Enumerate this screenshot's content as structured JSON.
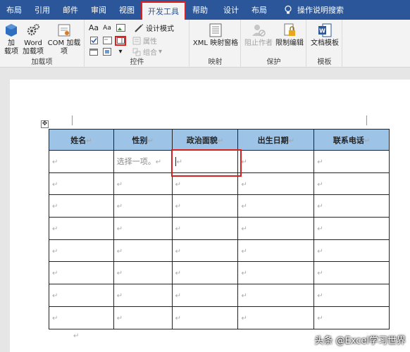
{
  "tabs": [
    "布局",
    "引用",
    "邮件",
    "审阅",
    "视图",
    "开发工具",
    "帮助",
    "设计",
    "布局"
  ],
  "active_tab": "开发工具",
  "tell_me": "操作说明搜索",
  "groups": {
    "addins": {
      "label": "加载项",
      "add_btn": "加\n载项",
      "word_btn": "Word\n加载项",
      "com_btn": "COM 加载项"
    },
    "controls": {
      "label": "控件",
      "design_mode": "设计模式",
      "properties": "属性",
      "group": "组合"
    },
    "mapping": {
      "label": "映射",
      "xml_btn": "XML 映射窗格"
    },
    "protect": {
      "label": "保护",
      "block_authors": "阻止作者",
      "restrict_edit": "限制编辑"
    },
    "templates": {
      "label": "模板",
      "doc_template": "文档模板"
    }
  },
  "table": {
    "headers": [
      "姓名",
      "性别",
      "政治面貌",
      "出生日期",
      "联系电话"
    ],
    "placeholder": "选择一项。",
    "return_mark": "↵",
    "rows": 8
  },
  "watermark": "头条 @Excel学习世界"
}
